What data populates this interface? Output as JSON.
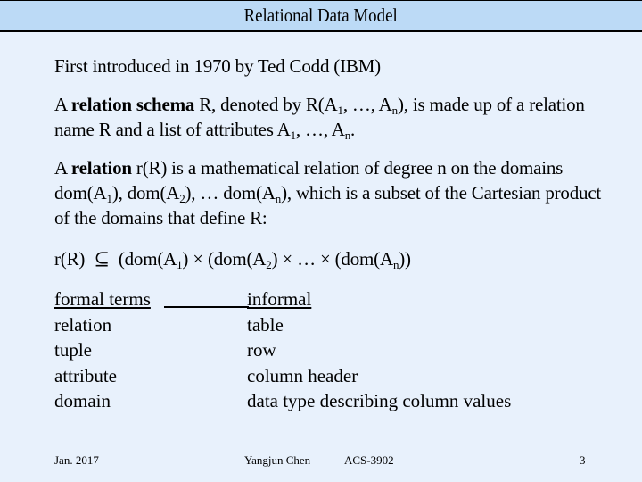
{
  "slide": {
    "title": "Relational Data Model",
    "intro": "First introduced in 1970 by Ted Codd (IBM)",
    "schema_para": {
      "p1": "A ",
      "bold": "relation schema",
      "p2": " R, denoted by R(A",
      "s1": "1",
      "p3": ", …, A",
      "s2": "n",
      "p4": "), is made up of a relation name R and a list of attributes A",
      "s3": "1",
      "p5": ", …, A",
      "s4": "n",
      "p6": "."
    },
    "relation_para": {
      "p1": "A ",
      "bold": "relation",
      "p2": " r(R) is a mathematical relation of degree n on the domains dom(A",
      "s1": "1",
      "p3": "), dom(A",
      "s2": "2",
      "p4": "), … dom(A",
      "s3": "n",
      "p5": "), which is a subset of the Cartesian product of the domains that define R:"
    },
    "formula": {
      "lhs": "r(R)",
      "subset_symbol": "⊆",
      "t1": "(dom(A",
      "s1": "1",
      "t2": ") × (dom(A",
      "s2": "2",
      "t3": ") × … × (dom(A",
      "s3": "n",
      "t4": "))"
    },
    "terms_table": {
      "headers": [
        "formal terms",
        "informal"
      ],
      "rows": [
        [
          "relation",
          "table"
        ],
        [
          "tuple",
          "row"
        ],
        [
          "attribute",
          "column header"
        ],
        [
          "domain",
          "data type describing column values"
        ]
      ]
    },
    "footer": {
      "date": "Jan. 2017",
      "author": "Yangjun Chen",
      "course": "ACS-3902",
      "page": "3"
    }
  }
}
